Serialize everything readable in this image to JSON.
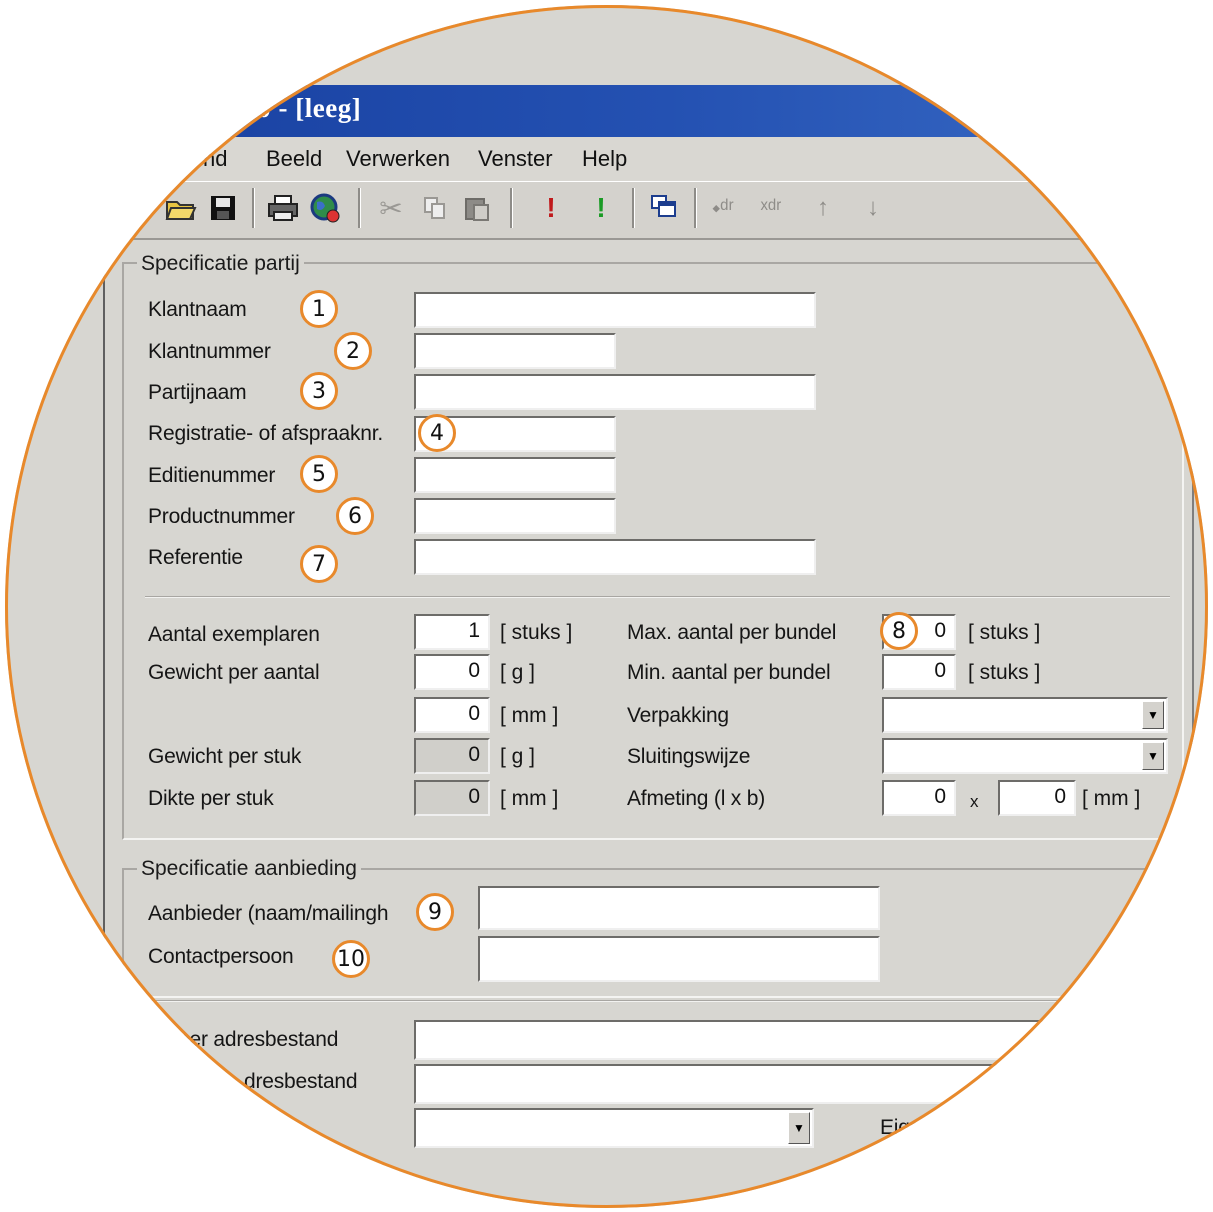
{
  "window": {
    "title": ".0 - [leeg]"
  },
  "menu": [
    "nd",
    "Beeld",
    "Verwerken",
    "Venster",
    "Help"
  ],
  "toolbar": {
    "icons": [
      "open-folder-icon",
      "save-icon",
      "print-icon",
      "globe-icon",
      "cut-icon",
      "copy-icon",
      "paste-icon",
      "red-exclamation-icon",
      "green-exclamation-icon",
      "windows-icon",
      "insert-icon",
      "delete-icon",
      "arrow-up-icon",
      "arrow-down-icon"
    ]
  },
  "spec_partij": {
    "legend": "Specificatie partij",
    "fields": [
      {
        "label": "Klantnaam",
        "value": "",
        "badge": "1"
      },
      {
        "label": "Klantnummer",
        "value": "",
        "badge": "2"
      },
      {
        "label": "Partijnaam",
        "value": "",
        "badge": "3"
      },
      {
        "label": "Registratie- of afspraaknr.",
        "value": "",
        "badge": "4"
      },
      {
        "label": "Editienummer",
        "value": "",
        "badge": "5"
      },
      {
        "label": "Productnummer",
        "value": "",
        "badge": "6"
      },
      {
        "label": "Referentie",
        "value": "",
        "badge": "7"
      }
    ]
  },
  "quantities": {
    "left": [
      {
        "label": "Aantal exemplaren",
        "value": "1",
        "unit": "[ stuks ]"
      },
      {
        "label": "Gewicht per aantal",
        "value": "0",
        "unit": "[ g ]"
      },
      {
        "label": "",
        "value": "0",
        "unit": "[ mm ]"
      },
      {
        "label": "Gewicht per stuk",
        "value": "0",
        "unit": "[ g ]"
      },
      {
        "label": "Dikte per stuk",
        "value": "0",
        "unit": "[ mm ]"
      }
    ],
    "right": {
      "max_label": "Max. aantal per bundel",
      "max_value": "0",
      "max_unit": "[ stuks ]",
      "max_badge": "8",
      "min_label": "Min. aantal per bundel",
      "min_value": "0",
      "min_unit": "[ stuks ]",
      "verpakking_label": "Verpakking",
      "verpakking_value": "",
      "sluiting_label": "Sluitingswijze",
      "sluiting_value": "",
      "afmeting_label": "Afmeting (l x b)",
      "afmeting_l": "0",
      "afmeting_x": "x",
      "afmeting_b": "0",
      "afmeting_unit": "[ mm ]"
    }
  },
  "spec_aanbieding": {
    "legend": "Specificatie aanbieding",
    "aanbieder_label": "Aanbieder (naam/mailingh",
    "aanbieder_value": "",
    "aanbieder_badge": "9",
    "contact_label": "Contactpersoon",
    "contact_value": "",
    "contact_badge": "10"
  },
  "address": {
    "row1_label": "per adresbestand",
    "row2_label": "dresbestand",
    "row3_right_label": "Eige",
    "row1_value": "",
    "row2_value": "",
    "row3_value": ""
  },
  "colors": {
    "badge_border": "#e8892b",
    "titlebar": "#163d9d"
  }
}
